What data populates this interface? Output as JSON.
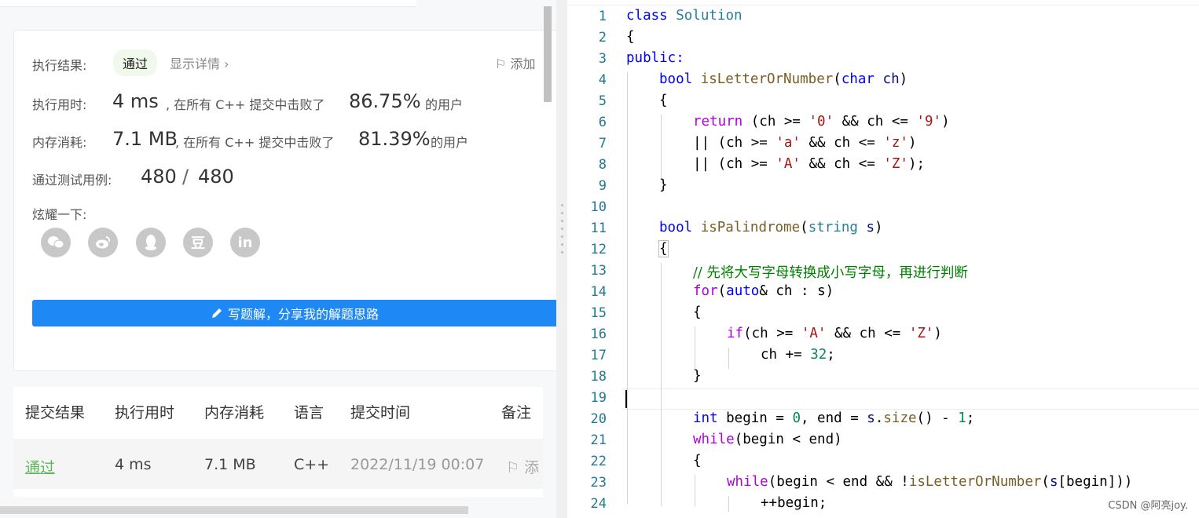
{
  "result": {
    "label_result": "执行结果:",
    "status": "通过",
    "detail_link": "显示详情",
    "add_note": "添加",
    "label_time": "执行用时:",
    "time_value": "4 ms",
    "time_mid": ", 在所有 C++ 提交中击败了",
    "time_pct": "86.75%",
    "time_tail": "的用户",
    "label_mem": "内存消耗:",
    "mem_value": "7.1 MB",
    "mem_mid": ", 在所有 C++ 提交中击败了",
    "mem_pct": "81.39%",
    "mem_tail": "的用户",
    "label_cases": "通过测试用例:",
    "cases_passed": "480",
    "cases_sep": "/",
    "cases_total": "480",
    "label_share": "炫耀一下:",
    "share_icons": [
      "wechat-icon",
      "weibo-icon",
      "qq-icon",
      "douban-icon",
      "linkedin-icon"
    ],
    "douban_glyph": "豆",
    "linkedin_glyph": "in",
    "write_solution": "写题解，分享我的解题思路"
  },
  "submissions": {
    "headers": [
      "提交结果",
      "执行用时",
      "内存消耗",
      "语言",
      "提交时间",
      "备注"
    ],
    "row": {
      "status": "通过",
      "time": "4 ms",
      "memory": "7.1 MB",
      "language": "C++",
      "submitted_at": "2022/11/19 00:07",
      "note": "添"
    }
  },
  "editor": {
    "line_numbers": [
      "1",
      "2",
      "3",
      "4",
      "5",
      "6",
      "7",
      "8",
      "9",
      "10",
      "11",
      "12",
      "13",
      "14",
      "15",
      "16",
      "17",
      "18",
      "19",
      "20",
      "21",
      "22",
      "23",
      "24"
    ],
    "tokens": {
      "l1_class": "class",
      "l1_name": "Solution",
      "l2": "{",
      "l3": "public:",
      "l4_bool": "bool",
      "l4_fn": "isLetterOrNumber",
      "l4_p1": "(",
      "l4_type": "char",
      "l4_var": "ch",
      "l4_p2": ")",
      "l5": "{",
      "l6_return": "return",
      "l6_a": " (ch >= ",
      "l6_s1": "'0'",
      "l6_b": " && ch <= ",
      "l6_s2": "'9'",
      "l6_c": ")",
      "l7_a": "|| (ch >= ",
      "l7_s1": "'a'",
      "l7_b": " && ch <= ",
      "l7_s2": "'z'",
      "l7_c": ")",
      "l8_a": "|| (ch >= ",
      "l8_s1": "'A'",
      "l8_b": " && ch <= ",
      "l8_s2": "'Z'",
      "l8_c": ");",
      "l9": "}",
      "l11_bool": "bool",
      "l11_fn": "isPalindrome",
      "l11_p1": "(",
      "l11_type": "string",
      "l11_var": "s",
      "l11_p2": ")",
      "l12": "{",
      "l13_comment": "// 先将大写字母转换成小写字母，再进行判断",
      "l14_for": "for",
      "l14_p1": "(",
      "l14_auto": "auto",
      "l14_rest": "& ch : s)",
      "l15": "{",
      "l16_if": "if",
      "l16_a": "(ch >= ",
      "l16_s1": "'A'",
      "l16_b": " && ch <= ",
      "l16_s2": "'Z'",
      "l16_c": ")",
      "l17_a": "ch += ",
      "l17_num": "32",
      "l17_b": ";",
      "l18": "}",
      "l20_int": "int",
      "l20_a": " begin = ",
      "l20_n0": "0",
      "l20_b": ", end = ",
      "l20_s": "s",
      "l20_c": ".",
      "l20_size": "size",
      "l20_d": "() - ",
      "l20_n1": "1",
      "l20_e": ";",
      "l21_while": "while",
      "l21_rest": "(begin < end)",
      "l22": "{",
      "l23_while": "while",
      "l23_a": "(begin < end && !",
      "l23_fn": "isLetterOrNumber",
      "l23_b": "(",
      "l23_s": "s",
      "l23_c": "[begin]))",
      "l24": "++begin;"
    }
  },
  "watermark": "CSDN @阿亮joy."
}
